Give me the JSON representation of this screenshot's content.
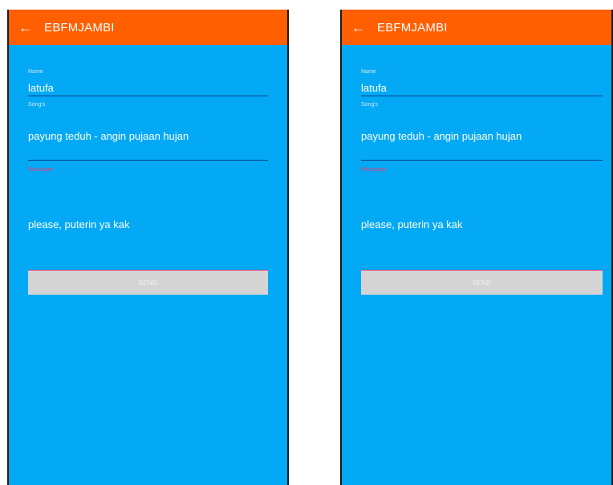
{
  "screens": [
    {
      "appbar": {
        "back_icon": "←",
        "title": "EBFMJAMBI"
      },
      "name": {
        "label": "Name",
        "value": "latufa"
      },
      "song": {
        "label": "Song's",
        "value": "payung teduh - angin pujaan hujan"
      },
      "message": {
        "label": "Messages",
        "value": "please, puterin ya kak"
      },
      "send_label": "SEND"
    },
    {
      "appbar": {
        "back_icon": "←",
        "title": "EBFMJAMBI"
      },
      "name": {
        "label": "Name",
        "value": "latufa"
      },
      "song": {
        "label": "Song's",
        "value": "payung teduh - angin pujaan hujan"
      },
      "message": {
        "label": "Messages",
        "value": "please, puterin ya kak"
      },
      "send_label": "SEND"
    }
  ],
  "colors": {
    "appbar": "#ff5f00",
    "background": "#03a9f4",
    "error": "#e4407a",
    "underline": "#0a3e8c",
    "button": "#d4d4d4"
  }
}
